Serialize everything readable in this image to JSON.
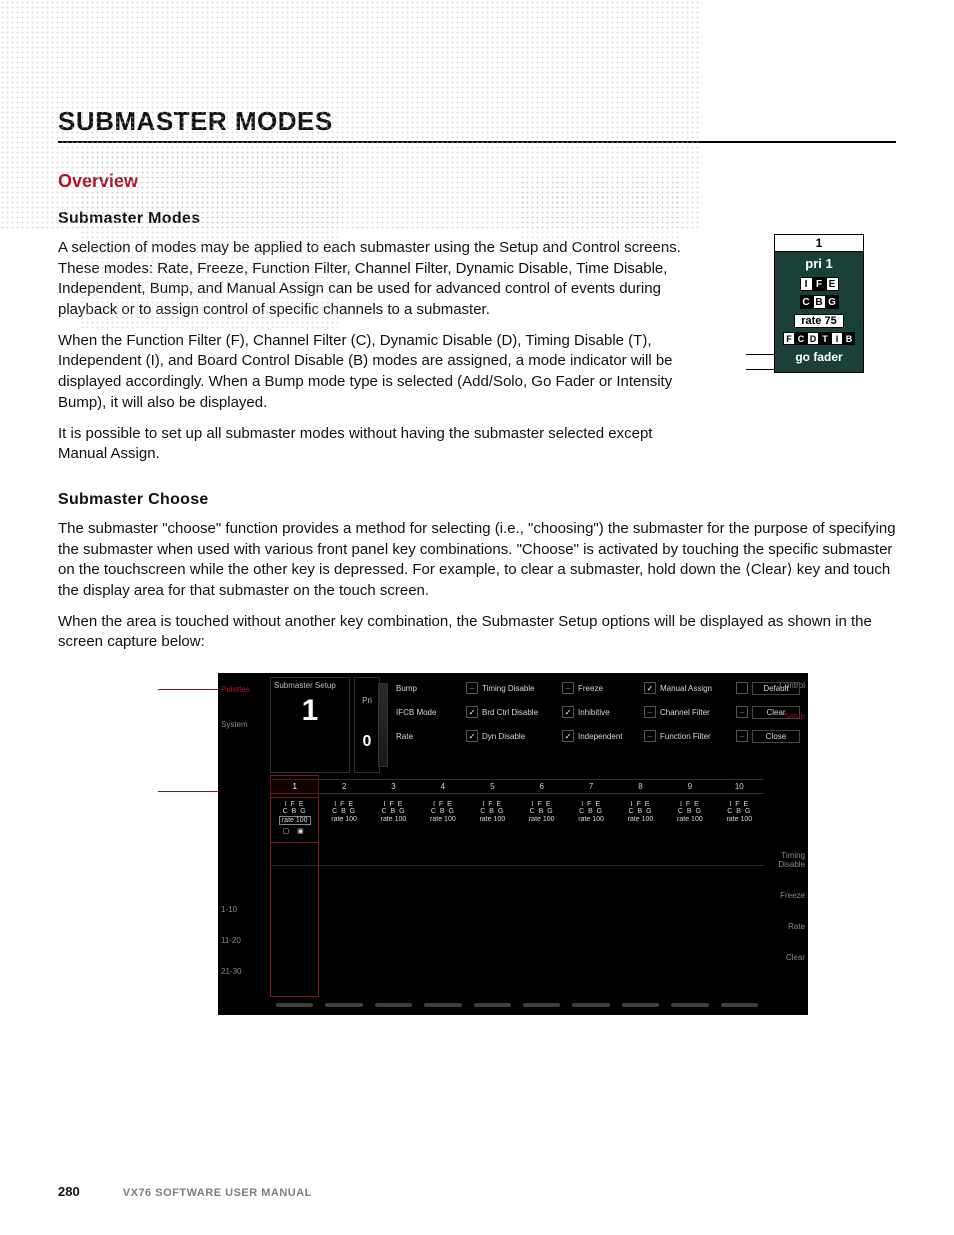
{
  "title": "SUBMASTER MODES",
  "overview_heading": "Overview",
  "subhead_modes": "Submaster Modes",
  "para1": "A selection of modes may be applied to each submaster using the Setup and Control screens. These modes: Rate, Freeze, Function Filter, Channel Filter, Dynamic Disable, Time Disable, Independent, Bump, and Manual Assign can be used for advanced control of events during playback or to assign control of specific channels to a submaster.",
  "para2": "When the Function Filter (F), Channel Filter (C), Dynamic Disable (D), Timing Disable (T), Independent (I), and Board Control Disable (B) modes are assigned, a mode indicator will be displayed accordingly. When a Bump mode type is selected (Add/Solo, Go Fader or Intensity Bump), it will also be displayed.",
  "para3": "It is possible to set up all submaster modes without having the submaster selected except Manual Assign.",
  "subhead_choose": "Submaster Choose",
  "para4": "The submaster \"choose\" function provides a method for selecting (i.e., \"choosing\") the submaster for the purpose of specifying the submaster when used with various front panel key combinations. \"Choose\" is activated by touching the specific submaster on the touchscreen while the other key is depressed. For example, to clear a submaster, hold down the ⟨Clear⟩ key and touch the display area for that submaster on the touch screen.",
  "para5": "When the area is touched without another key combination, the Submaster Setup options will be displayed as shown in the screen capture below:",
  "mode_diagram": {
    "num": "1",
    "pri": "pri 1",
    "row1": [
      "I",
      "F",
      "E"
    ],
    "row2": [
      "C",
      "B",
      "G"
    ],
    "rate": "rate 75",
    "fullrow": [
      "F",
      "C",
      "D",
      "T",
      "I",
      "B"
    ],
    "go": "go fader"
  },
  "ui": {
    "left_nav": {
      "palettes": "Palettes",
      "system": "System"
    },
    "right_nav": {
      "control": "Control",
      "setup": "Setup",
      "timing": "Timing\nDisable",
      "freeze": "Freeze",
      "rate": "Rate",
      "clear": "Clear"
    },
    "ranges": [
      "1-10",
      "11-20",
      "21-30"
    ],
    "sm_setup": {
      "label": "Submaster Setup",
      "pri_label": "Pri",
      "num": "1",
      "pri_val": "0"
    },
    "options": {
      "row1": [
        {
          "label": "Bump",
          "state": "off"
        },
        {
          "label": "Timing Disable",
          "state": "off"
        },
        {
          "label": "Freeze",
          "state": "on"
        },
        {
          "label": "Manual Assign",
          "state": ""
        },
        {
          "btn": "Default"
        }
      ],
      "row2": [
        {
          "label": "IFCB Mode",
          "state": "on"
        },
        {
          "label": "Brd Ctrl Disable",
          "state": "on"
        },
        {
          "label": "Inhibitive",
          "state": "off"
        },
        {
          "label": "Channel Filter",
          "state": "off"
        },
        {
          "btn": "Clear"
        }
      ],
      "row3": [
        {
          "label": "Rate",
          "state": "on"
        },
        {
          "label": "Dyn Disable",
          "state": "on"
        },
        {
          "label": "Independent",
          "state": "off"
        },
        {
          "label": "Function Filter",
          "state": "off"
        },
        {
          "btn": "Close"
        }
      ]
    },
    "columns": [
      "1",
      "2",
      "3",
      "4",
      "5",
      "6",
      "7",
      "8",
      "9",
      "10"
    ],
    "cell": {
      "ife": "I  F  E",
      "cbg": "C  B  G",
      "rate": "rate 100",
      "icons": "▢   ▣"
    }
  },
  "footer": {
    "page": "280",
    "manual": "VX76 SOFTWARE USER MANUAL"
  }
}
